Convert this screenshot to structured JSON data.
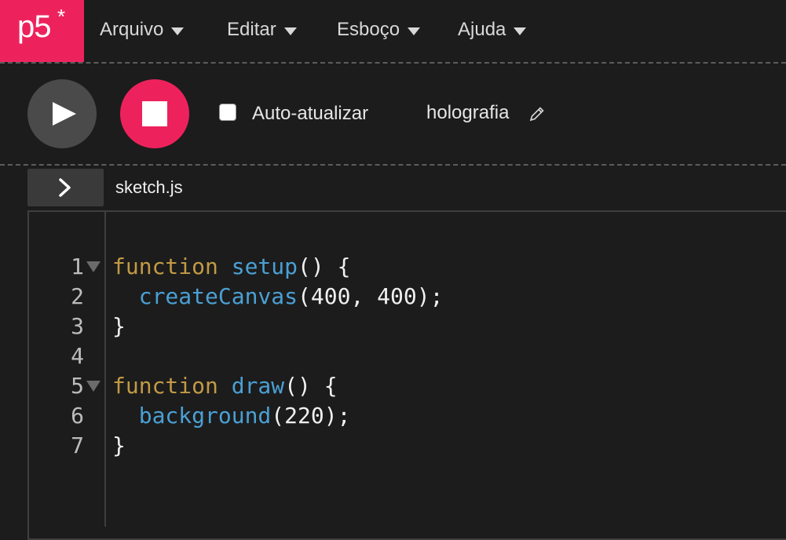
{
  "logo": {
    "text": "p5",
    "star": "*"
  },
  "menu": [
    {
      "label": "Arquivo"
    },
    {
      "label": "Editar"
    },
    {
      "label": "Esboço"
    },
    {
      "label": "Ajuda"
    }
  ],
  "toolbar": {
    "play_icon": "play-icon",
    "stop_icon": "stop-icon",
    "auto_refresh_label": "Auto-atualizar",
    "auto_refresh_checked": false,
    "sketch_name": "holografia",
    "edit_icon": "pencil-icon"
  },
  "tabs": {
    "expand_icon": "chevron-right-icon",
    "file_name": "sketch.js"
  },
  "editor": {
    "lines": [
      {
        "n": "1",
        "fold": true
      },
      {
        "n": "2",
        "fold": false
      },
      {
        "n": "3",
        "fold": false
      },
      {
        "n": "4",
        "fold": false
      },
      {
        "n": "5",
        "fold": true
      },
      {
        "n": "6",
        "fold": false
      },
      {
        "n": "7",
        "fold": false
      }
    ],
    "code": {
      "l1_kw": "function",
      "l1_fn": "setup",
      "l1_rest": "() {",
      "l2_fn": "createCanvas",
      "l2_rest": "(400, 400);",
      "l3": "}",
      "l5_kw": "function",
      "l5_fn": "draw",
      "l5_rest": "() {",
      "l6_fn": "background",
      "l6_rest": "(220);",
      "l7": "}"
    }
  },
  "colors": {
    "accent": "#ed225d",
    "keyword": "#c29a45",
    "function": "#4aa0d5",
    "background": "#1c1c1c"
  }
}
